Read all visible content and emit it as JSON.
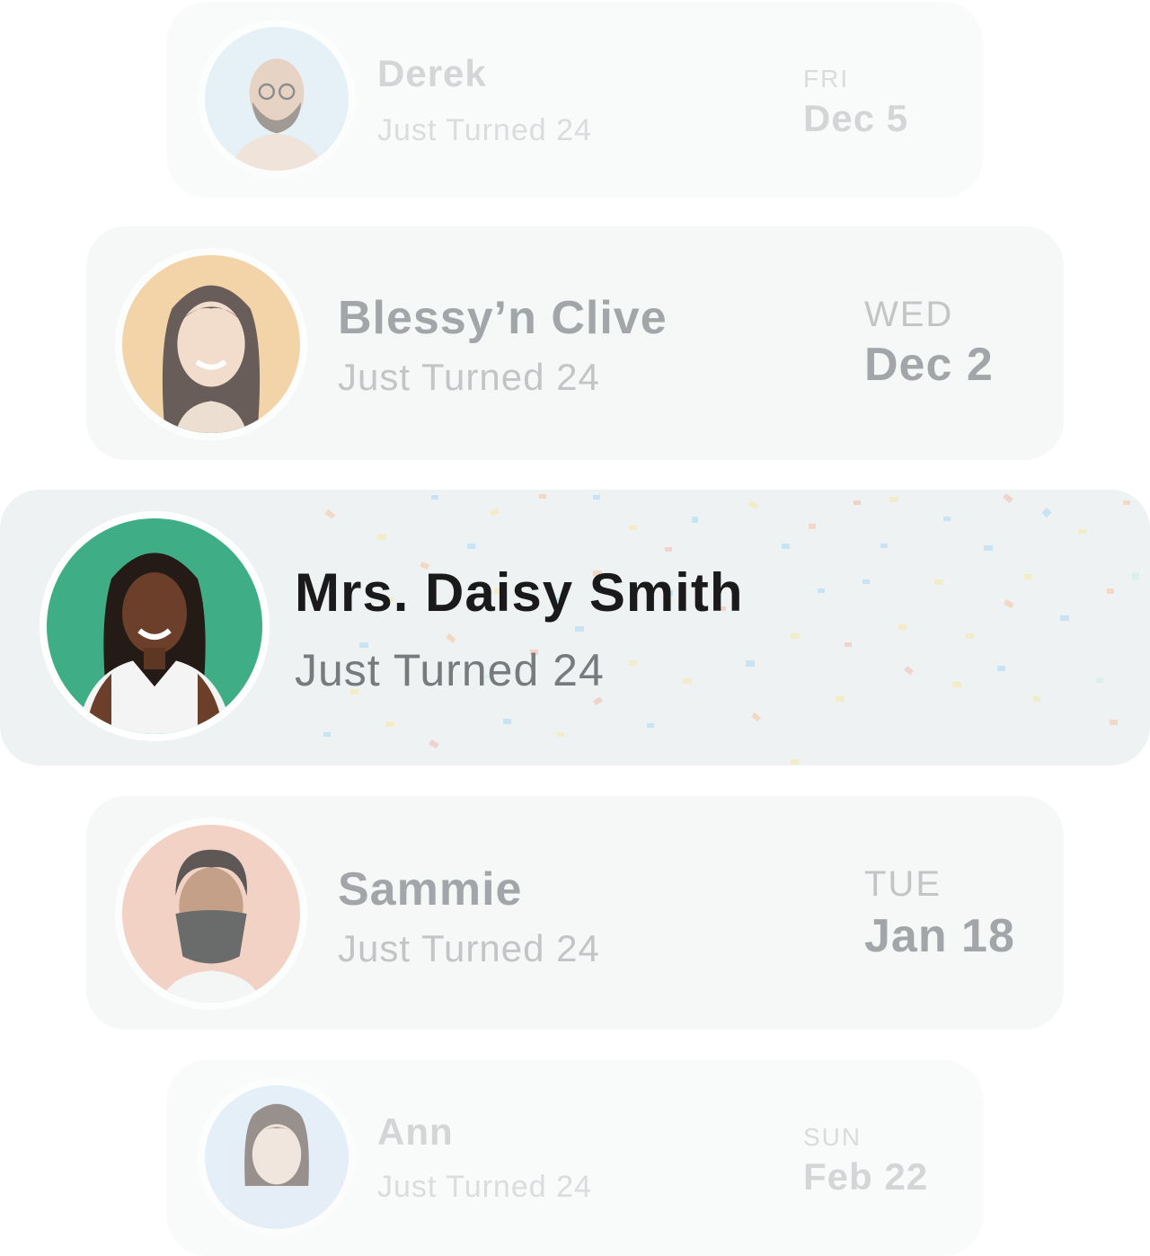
{
  "birthdays": [
    {
      "id": "derek",
      "name": "Derek",
      "subtitle": "Just Turned 24",
      "day_of_week": "FRI",
      "date": "Dec 5",
      "avatar_bg": "#d6eaf5"
    },
    {
      "id": "blessy",
      "name": "Blessy’n Clive",
      "subtitle": "Just Turned 24",
      "day_of_week": "WED",
      "date": "Dec 2",
      "avatar_bg": "#f3c98f"
    },
    {
      "id": "daisy",
      "name": "Mrs. Daisy Smith",
      "subtitle": "Just Turned 24",
      "day_of_week": "",
      "date": "",
      "avatar_bg": "#3fae86",
      "active": true
    },
    {
      "id": "sammie",
      "name": "Sammie",
      "subtitle": "Just Turned 24",
      "day_of_week": "TUE",
      "date": "Jan 18",
      "avatar_bg": "#f2c6b6"
    },
    {
      "id": "ann",
      "name": "Ann",
      "subtitle": "Just Turned 24",
      "day_of_week": "SUN",
      "date": "Feb 22",
      "avatar_bg": "#d6e6f5"
    }
  ],
  "confetti_colors": [
    "#f7c3a0",
    "#a9d7f0",
    "#f6e7a6",
    "#cfeee0",
    "#f4b9b0"
  ]
}
